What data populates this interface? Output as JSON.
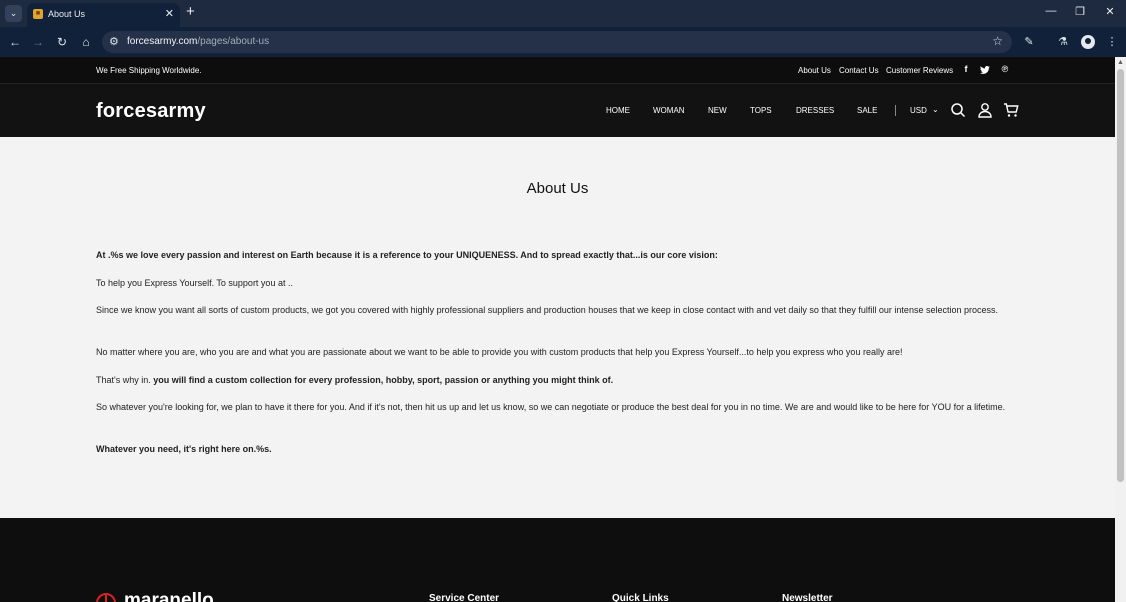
{
  "browser": {
    "tab_title": "About Us",
    "url_domain": "forcesarmy.com",
    "url_path": "/pages/about-us",
    "icons": {
      "tab_list": "chevron-down-icon",
      "favicon": "store-favicon-icon",
      "tab_close": "close-icon",
      "new_tab": "plus-icon",
      "minimize": "minimize-icon",
      "maximize": "restore-icon",
      "close": "close-icon",
      "back": "back-arrow-icon",
      "forward": "forward-arrow-icon",
      "reload": "reload-icon",
      "home": "home-icon",
      "site_info": "site-settings-icon",
      "bookmark": "star-icon",
      "extensions": "puzzle-icon",
      "labs": "flask-icon",
      "profile": "profile-icon",
      "menu": "kebab-menu-icon"
    }
  },
  "site": {
    "topbar": {
      "shipping_text": "We Free Shipping Worldwide.",
      "links": [
        "About Us",
        "Contact Us",
        "Customer Reviews"
      ],
      "social_icons": [
        "facebook-icon",
        "twitter-icon",
        "pinterest-icon"
      ]
    },
    "header": {
      "logo": "forcesarmy",
      "nav": [
        "HOME",
        "WOMAN",
        "NEW",
        "TOPS",
        "DRESSES",
        "SALE"
      ],
      "currency": "USD",
      "icons": [
        "search-icon",
        "account-icon",
        "cart-icon"
      ]
    },
    "page": {
      "title": "About Us",
      "p1": "At .%s we love every passion and interest on Earth because it is a reference to your UNIQUENESS. And to spread exactly that...is our core vision:",
      "p2": "To help you Express Yourself. To support you at ..",
      "p3": "Since we know you want all sorts of custom products, we got you covered with highly professional suppliers and production houses that we keep in close contact with and vet daily so that they fulfill our intense selection process.",
      "p4": "No matter where you are, who you are and what you are passionate about we want to be able to provide you with custom products that help you Express Yourself...to help you express who you really are!",
      "p5_plain": "That's why in. ",
      "p5_bold": "you will find a custom collection for every profession, hobby, sport, passion or anything you might think of.",
      "p6": "So whatever you're looking for, we plan to have it there for you. And if it's not, then hit us up and let us know, so we can negotiate or produce the best deal for you in no time. We are and would like to be here for YOU for a lifetime.",
      "p7": "Whatever you need, it's right here on.%s."
    },
    "footer": {
      "logo": "maranello",
      "headings": [
        "Service Center",
        "Quick Links",
        "Newsletter"
      ]
    }
  }
}
